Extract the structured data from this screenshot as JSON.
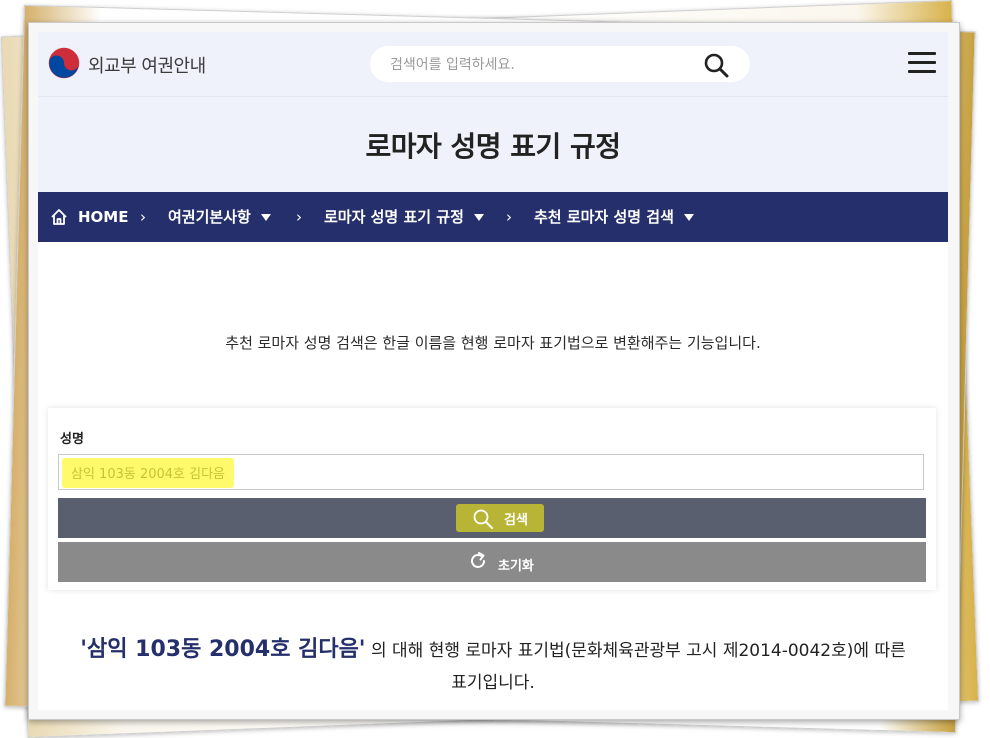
{
  "header": {
    "brand": "외교부 여권안내",
    "search_placeholder": "검색어를 입력하세요."
  },
  "page_title": "로마자 성명 표기 규정",
  "breadcrumb": {
    "home": "HOME",
    "items": [
      "여권기본사항",
      "로마자 성명 표기 규정",
      "추천 로마자 성명 검색"
    ]
  },
  "description": "추천 로마자 성명 검색은 한글 이름을 현행 로마자 표기법으로 변환해주는 기능입니다.",
  "form": {
    "name_label": "성명",
    "name_value": "삼익 103동 2004호 김다음",
    "search_label": "검색",
    "reset_label": "초기화"
  },
  "result": {
    "quoted_name": "'삼익 103동 2004호 김다음'",
    "text_line1": " 의 대해 현행 로마자 표기법(문화체육관광부 고시 제2014-0042호)에 따른",
    "text_line2": "표기입니다."
  },
  "colors": {
    "navy": "#242f6b",
    "band": "#eff1fb",
    "search_button": "#5a5f70",
    "reset_button": "#8a8a8a",
    "highlight": "#fff83a"
  }
}
